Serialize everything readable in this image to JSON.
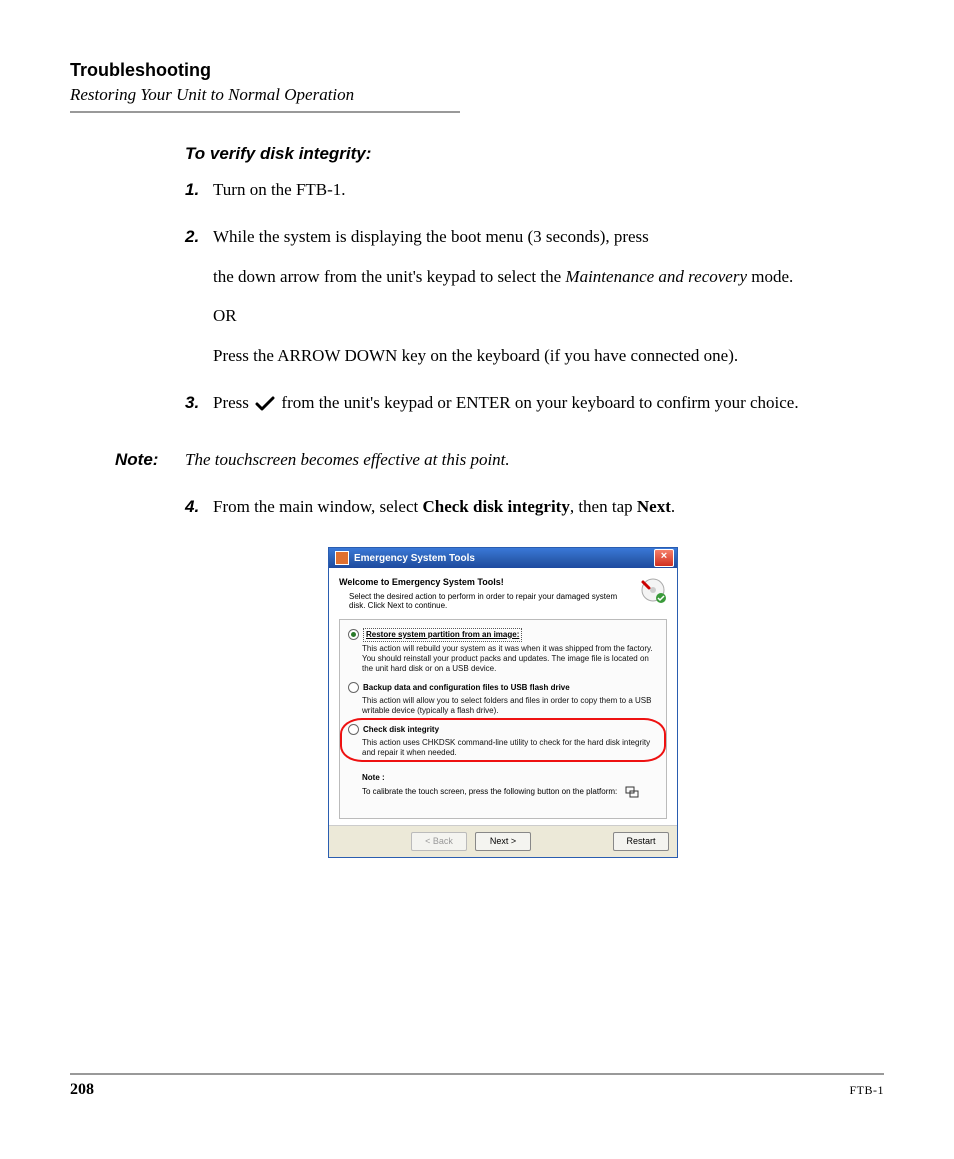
{
  "header": {
    "chapter": "Troubleshooting",
    "section": "Restoring Your Unit to Normal Operation"
  },
  "task": {
    "heading": "To verify disk integrity:",
    "steps": [
      {
        "num": "1.",
        "paras": [
          "Turn on the FTB-1."
        ]
      },
      {
        "num": "2.",
        "paras": [
          "While the system is displaying the boot menu (3 seconds), press",
          "the down arrow from the unit's keypad to select the <span class=\"italic\">Maintenance and recovery</span> mode.",
          "OR",
          "Press the ARROW DOWN key on the keyboard (if you have connected one)."
        ]
      },
      {
        "num": "3.",
        "paras_html": "Press <span class=\"check-icon\" data-name=\"check-icon\" data-interactable=\"false\"><svg width=\"20\" height=\"16\" viewBox=\"0 0 20 16\"><path d=\"M2 8 L7 13 L18 2\" stroke=\"#000\" stroke-width=\"3\" fill=\"none\" stroke-linecap=\"round\" stroke-linejoin=\"round\"/></svg></span> from the unit's keypad or ENTER on your keyboard to confirm your choice."
      },
      {
        "num": "4.",
        "paras_html": "From the main window, select <span class=\"bold\">Check disk integrity</span>, then tap <span class=\"bold\">Next</span>."
      }
    ]
  },
  "note": {
    "label": "Note:",
    "text": "The touchscreen becomes effective at this point."
  },
  "dialog": {
    "title": "Emergency System Tools",
    "welcome_title": "Welcome to Emergency System Tools!",
    "welcome_sub": "Select the desired action to perform in order to repair your damaged system disk. Click Next to continue.",
    "options": [
      {
        "id": "restore",
        "checked": true,
        "label": "Restore system partition from an image:",
        "dashed": true,
        "desc": "This action will rebuild your system as it was when it was shipped from the factory. You should reinstall your product packs and updates. The image file is located on the unit hard disk or on a USB device.",
        "highlight": false
      },
      {
        "id": "backup",
        "checked": false,
        "label": "Backup data and configuration files to USB flash drive",
        "dashed": false,
        "desc": "This action will allow you to select folders and files in order to copy them to a USB writable device (typically a flash drive).",
        "highlight": false
      },
      {
        "id": "checkdisk",
        "checked": false,
        "label": "Check disk integrity",
        "dashed": false,
        "desc": "This action uses CHKDSK command-line utility to check for the hard disk integrity and repair it when needed.",
        "highlight": true
      }
    ],
    "note_label": "Note :",
    "note_text": "To calibrate the touch screen, press the following button on the platform:",
    "buttons": {
      "back": "< Back",
      "next": "Next >",
      "restart": "Restart"
    }
  },
  "footer": {
    "page": "208",
    "doc": "FTB-1"
  }
}
